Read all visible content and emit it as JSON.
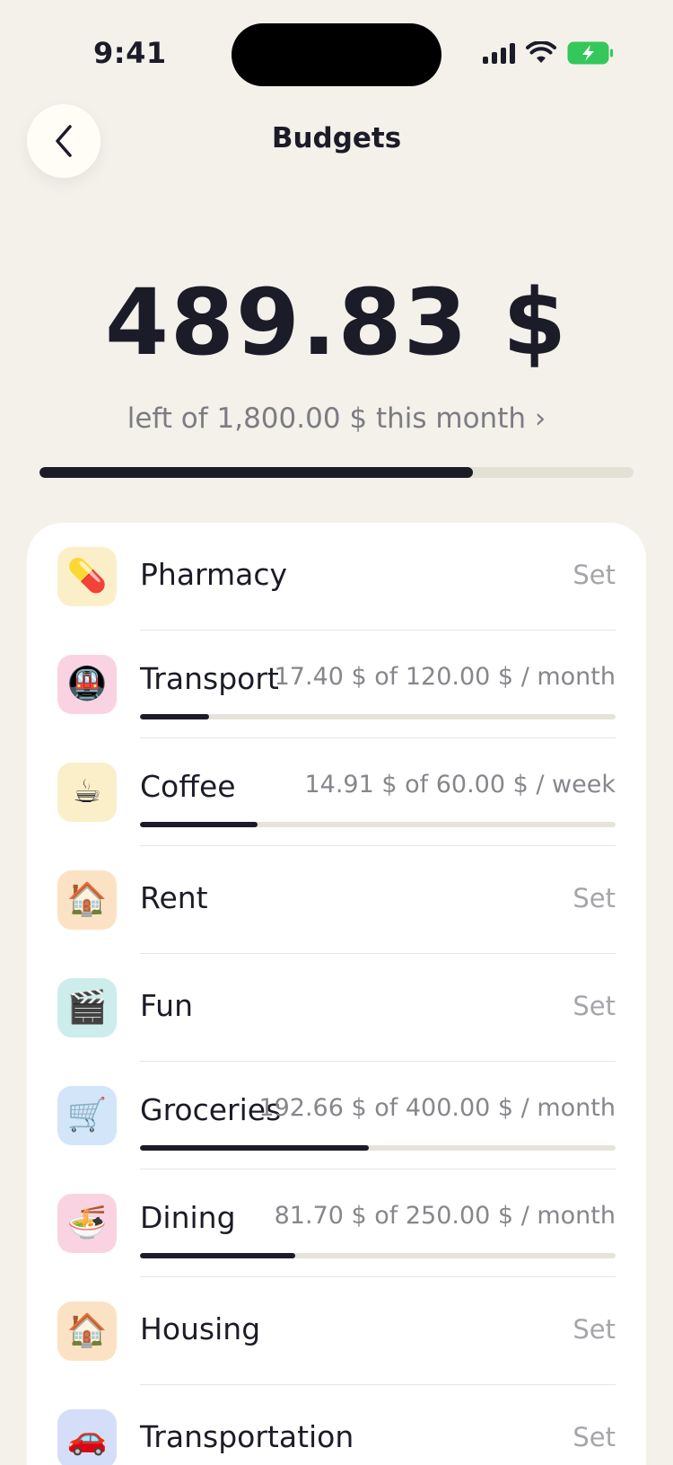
{
  "status_bar": {
    "time": "9:41"
  },
  "header": {
    "title": "Budgets"
  },
  "summary": {
    "amount": "489.83 $",
    "subtitle": "left of 1,800.00 $ this month",
    "chevron": "›",
    "progress": 0.73
  },
  "colors": {
    "background": "#F3F1EA",
    "card": "#FFFFFF",
    "accent": "#1C1C28",
    "track": "#E3E0D6",
    "battery": "#34C759"
  },
  "budgets": [
    {
      "name": "Pharmacy",
      "icon": "💊",
      "icon_name": "pill-icon",
      "icon_bg": "#FBEFC9",
      "set_label": "Set"
    },
    {
      "name": "Transport",
      "icon": "🚇",
      "icon_name": "metro-icon",
      "icon_bg": "#FAD3E2",
      "amount": "17.40 $ of 120.00 $ / month",
      "progress": 0.145
    },
    {
      "name": "Coffee",
      "icon": "☕",
      "icon_name": "coffee-icon",
      "icon_bg": "#FBEFC9",
      "amount": "14.91 $ of 60.00 $ / week",
      "progress": 0.248
    },
    {
      "name": "Rent",
      "icon": "🏠",
      "icon_name": "house-icon",
      "icon_bg": "#FCE2C5",
      "set_label": "Set"
    },
    {
      "name": "Fun",
      "icon": "🎬",
      "icon_name": "clapper-board-icon",
      "icon_bg": "#CDEDEA",
      "set_label": "Set"
    },
    {
      "name": "Groceries",
      "icon": "🛒",
      "icon_name": "shopping-cart-icon",
      "icon_bg": "#D3E5F8",
      "amount": "192.66 $ of 400.00 $ / month",
      "progress": 0.482
    },
    {
      "name": "Dining",
      "icon": "🍜",
      "icon_name": "noodle-bowl-icon",
      "icon_bg": "#FAD3E2",
      "amount": "81.70 $ of 250.00 $ / month",
      "progress": 0.327
    },
    {
      "name": "Housing",
      "icon": "🏠",
      "icon_name": "house-icon",
      "icon_bg": "#FCE2C5",
      "set_label": "Set"
    },
    {
      "name": "Transportation",
      "icon": "🚗",
      "icon_name": "car-icon",
      "icon_bg": "#D4DEF8",
      "set_label": "Set"
    }
  ]
}
